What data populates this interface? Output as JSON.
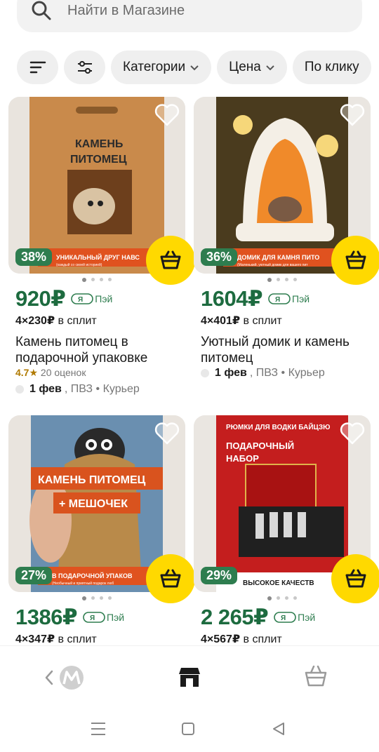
{
  "search": {
    "placeholder": "Найти в Магазине"
  },
  "filters": {
    "categories_label": "Категории",
    "price_label": "Цена",
    "one_click_label": "По клику"
  },
  "products": [
    {
      "discount": "38%",
      "price": "920₽",
      "pay_label": "Пэй",
      "split_amount": "4×230₽",
      "split_label": "в сплит",
      "title": "Камень питомец в подарочной упаковке",
      "rating": "4.7★",
      "reviews": "20 оценок",
      "delivery_date": "1 фев",
      "delivery_options": ", ПВЗ • Курьер",
      "image_text": [
        "КАМЕНЬ",
        "ПИТОМЕЦ"
      ],
      "banner_text": "УНИКАЛЬНЫЙ ДРУГ НАВС",
      "banner_subtext": "(каждый со своей историей)"
    },
    {
      "discount": "36%",
      "price": "1604₽",
      "pay_label": "Пэй",
      "split_amount": "4×401₽",
      "split_label": "в сплит",
      "title": "Уютный домик и камень питомец",
      "delivery_date": "1 фев",
      "delivery_options": ", ПВЗ • Курьер",
      "banner_text": "ДОМИК ДЛЯ КАМНЯ ПИТО",
      "banner_subtext": "(Маленький, уютный домик для вашего пит"
    },
    {
      "discount": "27%",
      "price": "1386₽",
      "pay_label": "Пэй",
      "split_amount": "4×347₽",
      "split_label": "в сплит",
      "image_text": [
        "КАМЕНЬ ПИТОМЕЦ",
        "+ МЕШОЧЕК"
      ],
      "banner_text": "В ПОДАРОЧНОЙ УПАКОВ",
      "banner_subtext": "(Необычный и приятный подарок люб"
    },
    {
      "discount": "29%",
      "price": "2 265₽",
      "pay_label": "Пэй",
      "split_amount": "4×567₽",
      "split_label": "в сплит",
      "image_text": [
        "РЮМКИ ДЛЯ ВОДКИ БАЙЦЗЮ",
        "ПОДАРОЧНЫЙ",
        "НАБОР"
      ],
      "banner_text": "ВЫСОКОЕ КАЧЕСТВ"
    }
  ],
  "colors": {
    "price_green": "#1d6b3f",
    "badge_green": "#2e7d4f",
    "cart_yellow": "#ffd900"
  },
  "icons": [
    "search-icon",
    "sort-icon",
    "filter-settings-icon",
    "chevron-down-icon",
    "heart-icon",
    "basket-icon",
    "back-chevron-icon",
    "market-logo-icon",
    "store-icon",
    "cart-outline-icon",
    "menu-lines-icon",
    "home-square-icon",
    "back-triangle-icon"
  ]
}
